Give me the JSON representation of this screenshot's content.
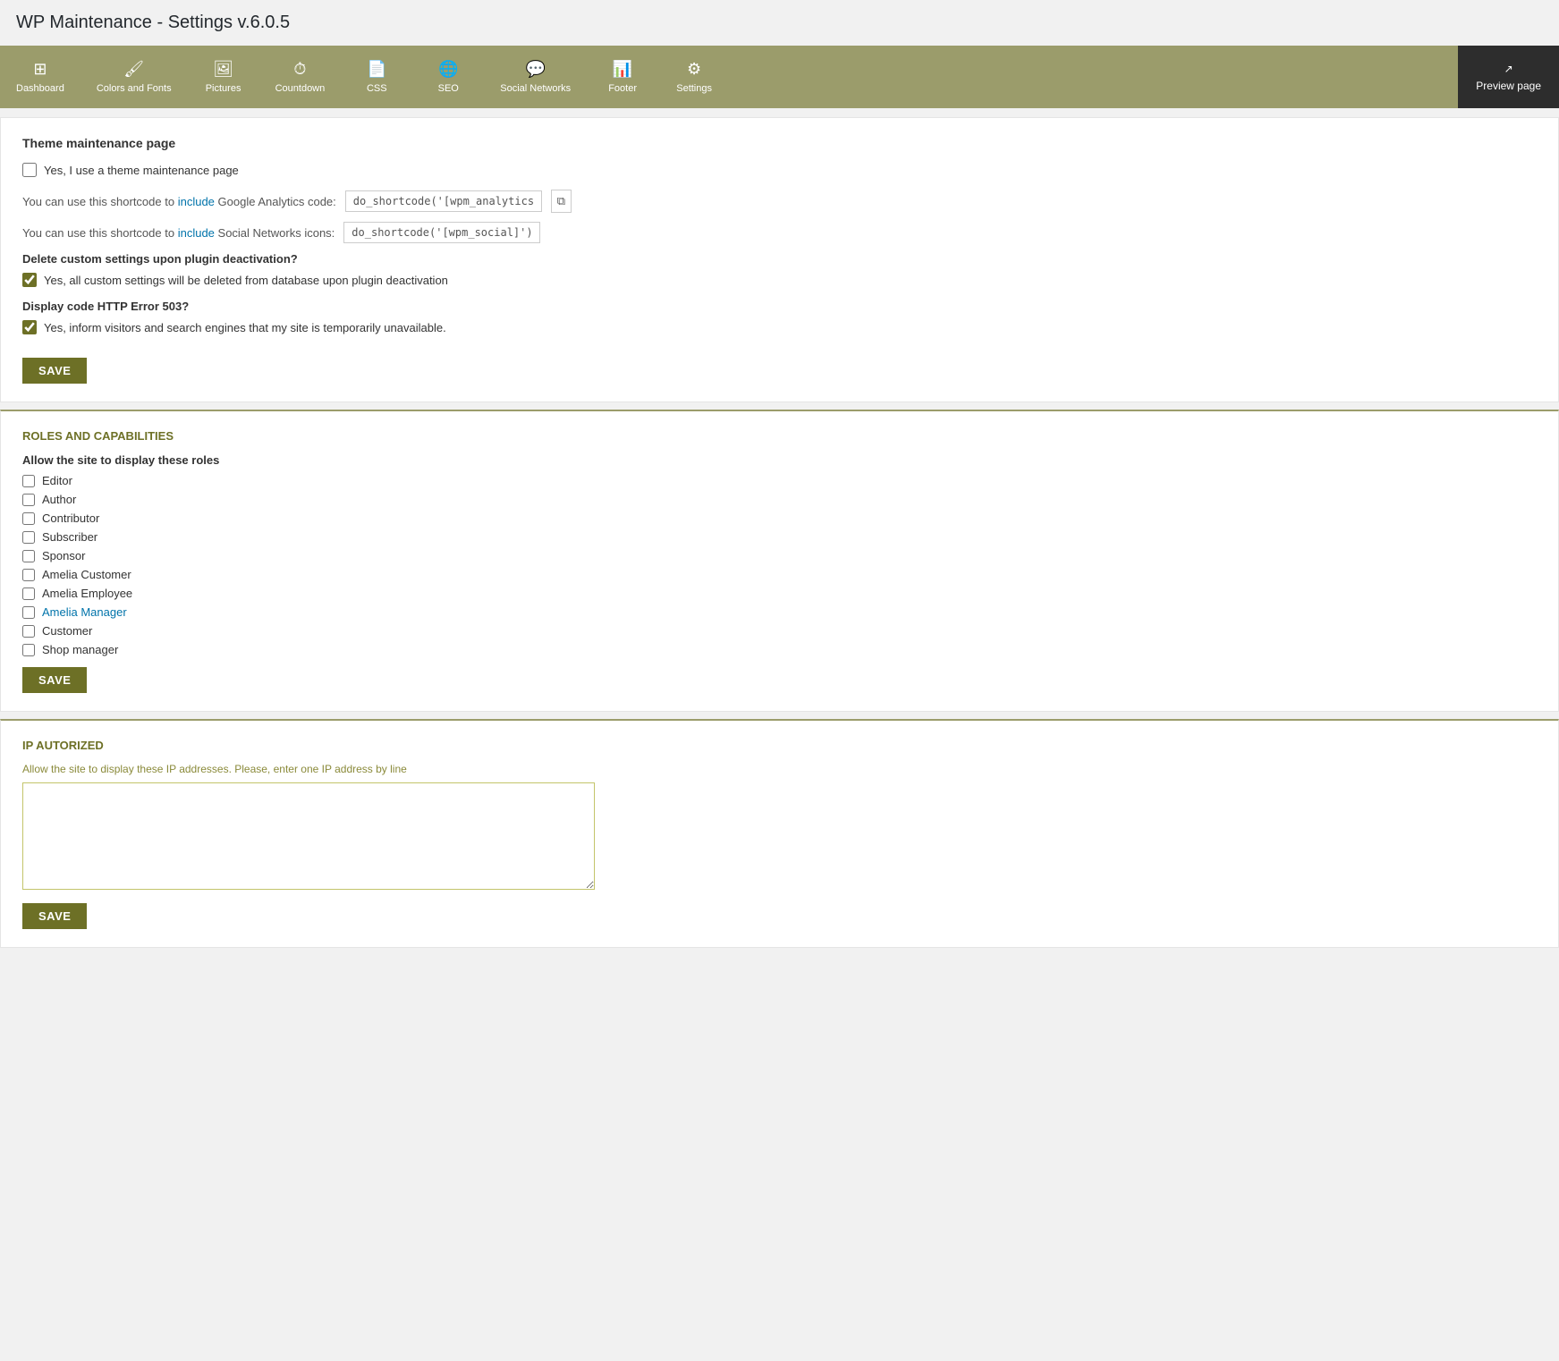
{
  "pageTitle": "WP Maintenance - Settings v.6.0.5",
  "nav": {
    "items": [
      {
        "id": "dashboard",
        "icon": "⊞",
        "label": "Dashboard"
      },
      {
        "id": "colors-fonts",
        "icon": "🖌",
        "label": "Colors and Fonts"
      },
      {
        "id": "pictures",
        "icon": "🖼",
        "label": "Pictures"
      },
      {
        "id": "countdown",
        "icon": "⏱",
        "label": "Countdown"
      },
      {
        "id": "css",
        "icon": "📄",
        "label": "CSS"
      },
      {
        "id": "seo",
        "icon": "🌐",
        "label": "SEO"
      },
      {
        "id": "social-networks",
        "icon": "💬",
        "label": "Social Networks"
      },
      {
        "id": "footer",
        "icon": "📊",
        "label": "Footer"
      },
      {
        "id": "settings",
        "icon": "⚙",
        "label": "Settings"
      }
    ],
    "previewLabel": "Preview page"
  },
  "themeMaintenance": {
    "sectionTitle": "Theme maintenance page",
    "checkboxLabel": "Yes, I use a theme maintenance page",
    "analyticsLabel": "You can use this shortcode to include Google Analytics code:",
    "analyticsValue": "do_shortcode('[wpm_analytics]');",
    "socialLabel": "You can use this shortcode to include Social Networks icons:",
    "socialValue": "do_shortcode('[wpm_social]');"
  },
  "deleteSettings": {
    "title": "Delete custom settings upon plugin deactivation?",
    "checkboxLabel": "Yes, all custom settings will be deleted from database upon plugin deactivation",
    "checked": true
  },
  "httpError": {
    "title": "Display code HTTP Error 503?",
    "checkboxLabel": "Yes, inform visitors and search engines that my site is temporarily unavailable.",
    "checked": true
  },
  "saveButton1": "SAVE",
  "rolesSection": {
    "title": "ROLES AND CAPABILITIES",
    "subTitle": "Allow the site to display these roles",
    "roles": [
      {
        "id": "editor",
        "label": "Editor",
        "checked": false,
        "isLink": false
      },
      {
        "id": "author",
        "label": "Author",
        "checked": false,
        "isLink": false
      },
      {
        "id": "contributor",
        "label": "Contributor",
        "checked": false,
        "isLink": false
      },
      {
        "id": "subscriber",
        "label": "Subscriber",
        "checked": false,
        "isLink": false
      },
      {
        "id": "sponsor",
        "label": "Sponsor",
        "checked": false,
        "isLink": false
      },
      {
        "id": "amelia-customer",
        "label": "Amelia Customer",
        "checked": false,
        "isLink": false
      },
      {
        "id": "amelia-employee",
        "label": "Amelia Employee",
        "checked": false,
        "isLink": false
      },
      {
        "id": "amelia-manager",
        "label": "Amelia Manager",
        "checked": false,
        "isLink": true
      },
      {
        "id": "customer",
        "label": "Customer",
        "checked": false,
        "isLink": false
      },
      {
        "id": "shop-manager",
        "label": "Shop manager",
        "checked": false,
        "isLink": false
      }
    ]
  },
  "saveButton2": "SAVE",
  "ipSection": {
    "title": "IP AUTORIZED",
    "description": "Allow the site to display these IP addresses. Please, enter one IP address by line",
    "placeholder": ""
  },
  "saveButton3": "SAVE"
}
